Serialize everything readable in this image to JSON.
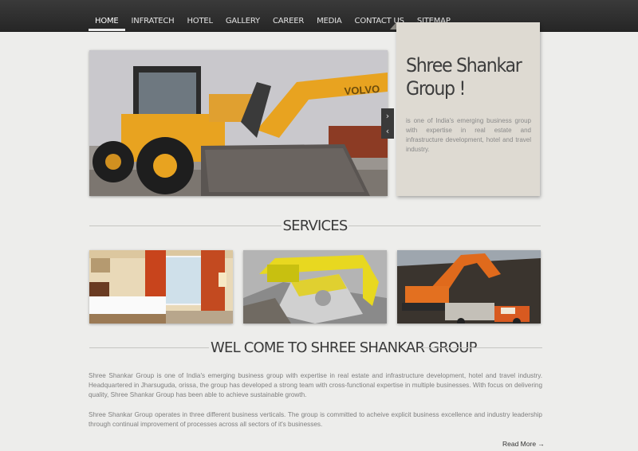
{
  "nav": {
    "items": [
      {
        "label": "HOME",
        "active": true
      },
      {
        "label": "INFRATECH"
      },
      {
        "label": "HOTEL"
      },
      {
        "label": "GALLERY"
      },
      {
        "label": "CAREER"
      },
      {
        "label": "MEDIA"
      },
      {
        "label": "CONTACT US"
      },
      {
        "label": "SITEMAP"
      }
    ]
  },
  "slider": {
    "next_icon": "›",
    "prev_icon": "‹"
  },
  "intro": {
    "title": "Shree Shankar Group !",
    "text": "is one of India's emerging business group with expertise in real estate and infrastructure development, hotel and travel industry."
  },
  "services": {
    "title": "SERVICES"
  },
  "welcome": {
    "title": "WEL COME TO SHREE SHANKAR GROUP",
    "para1": "Shree Shankar Group is one of India's emerging business group with expertise in real estate and infrastructure development, hotel and travel industry. Headquartered in Jharsuguda, orissa, the group has developed a strong team with cross-functional expertise in multiple businesses. With focus on delivering quality, Shree Shankar Group has been able to achieve sustainable growth.",
    "para2": "Shree Shankar Group operates in three different business verticals. The group is committed to acheive explicit business excellence and industry leadership through continual improvement of processes across all sectors of it's businesses.",
    "read_more": "Read More →"
  },
  "colors": {
    "topbar": "#2e2e2e",
    "intro_box": "#dedad2",
    "machinery_yellow": "#e8a320"
  }
}
